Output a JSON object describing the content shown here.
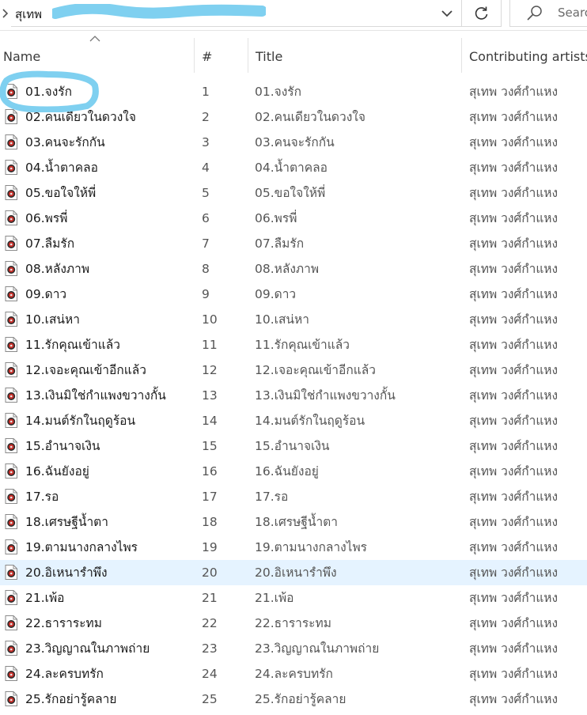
{
  "address_bar": {
    "path_visible": "สุเทพ",
    "search_placeholder": "Search"
  },
  "columns": {
    "name": "Name",
    "number": "#",
    "title": "Title",
    "artists": "Contributing artists"
  },
  "colors": {
    "selected_row": "#e5f3ff",
    "annotation": "#7fd0f0"
  },
  "selected_index": 19,
  "rows": [
    {
      "name": "01.จงรัก",
      "num": "1",
      "title": "01.จงรัก",
      "artist": "สุเทพ วงศ์กำแหง"
    },
    {
      "name": "02.คนเดียวในดวงใจ",
      "num": "2",
      "title": "02.คนเดียวในดวงใจ",
      "artist": "สุเทพ วงศ์กำแหง"
    },
    {
      "name": "03.คนจะรักกัน",
      "num": "3",
      "title": "03.คนจะรักกัน",
      "artist": "สุเทพ วงศ์กำแหง"
    },
    {
      "name": "04.น้ำตาคลอ",
      "num": "4",
      "title": "04.น้ำตาคลอ",
      "artist": "สุเทพ วงศ์กำแหง"
    },
    {
      "name": "05.ขอใจให้พี่",
      "num": "5",
      "title": "05.ขอใจให้พี่",
      "artist": "สุเทพ วงศ์กำแหง"
    },
    {
      "name": "06.พรพี่",
      "num": "6",
      "title": "06.พรพี่",
      "artist": "สุเทพ วงศ์กำแหง"
    },
    {
      "name": "07.ลืมรัก",
      "num": "7",
      "title": "07.ลืมรัก",
      "artist": "สุเทพ วงศ์กำแหง"
    },
    {
      "name": "08.หลังภาพ",
      "num": "8",
      "title": "08.หลังภาพ",
      "artist": "สุเทพ วงศ์กำแหง"
    },
    {
      "name": "09.ดาว",
      "num": "9",
      "title": "09.ดาว",
      "artist": "สุเทพ วงศ์กำแหง"
    },
    {
      "name": "10.เสน่หา",
      "num": "10",
      "title": "10.เสน่หา",
      "artist": "สุเทพ วงศ์กำแหง"
    },
    {
      "name": "11.รักคุณเข้าแล้ว",
      "num": "11",
      "title": "11.รักคุณเข้าแล้ว",
      "artist": "สุเทพ วงศ์กำแหง"
    },
    {
      "name": "12.เจอะคุณเข้าอีกแล้ว",
      "num": "12",
      "title": "12.เจอะคุณเข้าอีกแล้ว",
      "artist": "สุเทพ วงศ์กำแหง"
    },
    {
      "name": "13.เงินมิใช่กำแพงขวางกั้น",
      "num": "13",
      "title": "13.เงินมิใช่กำแพงขวางกั้น",
      "artist": "สุเทพ วงศ์กำแหง"
    },
    {
      "name": "14.มนต์รักในฤดูร้อน",
      "num": "14",
      "title": "14.มนต์รักในฤดูร้อน",
      "artist": "สุเทพ วงศ์กำแหง"
    },
    {
      "name": "15.อำนาจเงิน",
      "num": "15",
      "title": "15.อำนาจเงิน",
      "artist": "สุเทพ วงศ์กำแหง"
    },
    {
      "name": "16.ฉันยังอยู่",
      "num": "16",
      "title": "16.ฉันยังอยู่",
      "artist": "สุเทพ วงศ์กำแหง"
    },
    {
      "name": "17.รอ",
      "num": "17",
      "title": "17.รอ",
      "artist": "สุเทพ วงศ์กำแหง"
    },
    {
      "name": "18.เศรษฐีน้ำตา",
      "num": "18",
      "title": "18.เศรษฐีน้ำตา",
      "artist": "สุเทพ วงศ์กำแหง"
    },
    {
      "name": "19.ตามนางกลางไพร",
      "num": "19",
      "title": "19.ตามนางกลางไพร",
      "artist": "สุเทพ วงศ์กำแหง"
    },
    {
      "name": "20.อิเหนารำพึง",
      "num": "20",
      "title": "20.อิเหนารำพึง",
      "artist": "สุเทพ วงศ์กำแหง"
    },
    {
      "name": "21.เพ้อ",
      "num": "21",
      "title": "21.เพ้อ",
      "artist": "สุเทพ วงศ์กำแหง"
    },
    {
      "name": "22.ธาราระทม",
      "num": "22",
      "title": "22.ธาราระทม",
      "artist": "สุเทพ วงศ์กำแหง"
    },
    {
      "name": "23.วิญญาณในภาพถ่าย",
      "num": "23",
      "title": "23.วิญญาณในภาพถ่าย",
      "artist": "สุเทพ วงศ์กำแหง"
    },
    {
      "name": "24.ละครบทรัก",
      "num": "24",
      "title": "24.ละครบทรัก",
      "artist": "สุเทพ วงศ์กำแหง"
    },
    {
      "name": "25.รักอย่ารู้คลาย",
      "num": "25",
      "title": "25.รักอย่ารู้คลาย",
      "artist": "สุเทพ วงศ์กำแหง"
    }
  ]
}
